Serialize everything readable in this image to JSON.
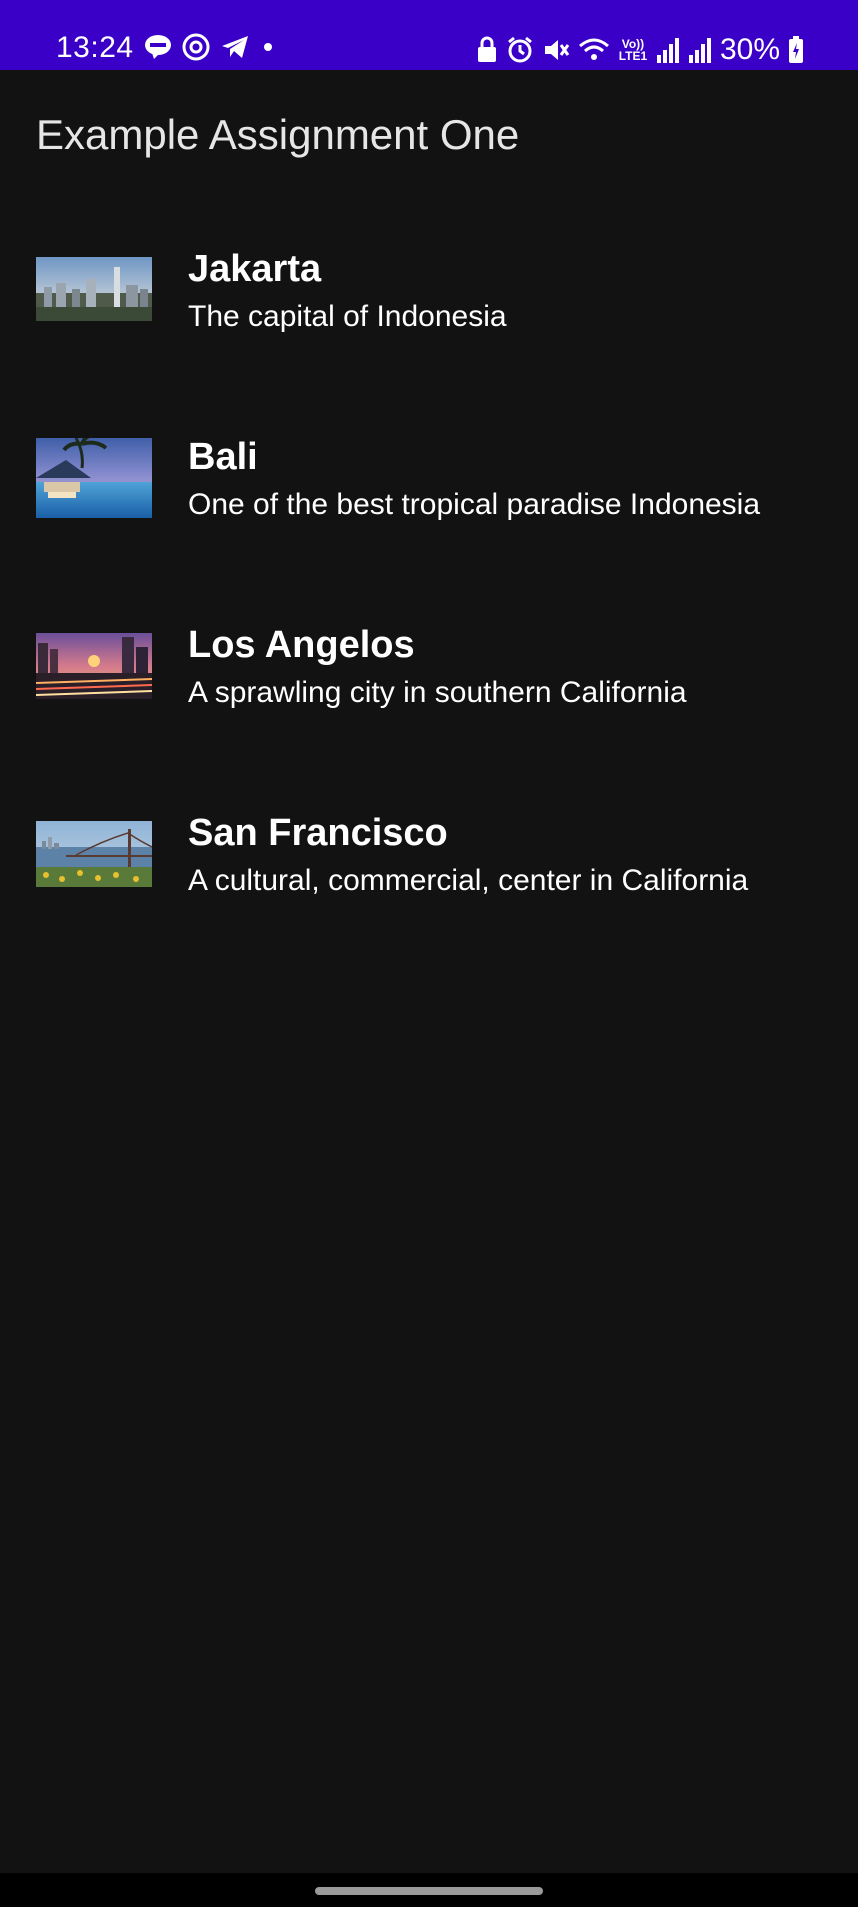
{
  "status_bar": {
    "time": "13:24",
    "battery": "30%",
    "lte_label": "Vo)) LTE1",
    "icons_left": [
      "line-icon",
      "messenger-icon",
      "telegram-icon",
      "dot-icon"
    ],
    "icons_right": [
      "lock-icon",
      "alarm-icon",
      "mute-icon",
      "wifi-icon",
      "lte-icon",
      "signal-icon",
      "signal-icon",
      "battery-icon"
    ]
  },
  "app_bar": {
    "title": "Example Assignment One"
  },
  "cities": [
    {
      "name": "Jakarta",
      "description": "The capital of Indonesia"
    },
    {
      "name": "Bali",
      "description": "One of the best tropical paradise Indonesia"
    },
    {
      "name": "Los Angelos",
      "description": "A sprawling city in southern California"
    },
    {
      "name": "San Francisco",
      "description": "A cultural, commercial, center in California"
    }
  ],
  "colors": {
    "status_bar": "#3a00c8",
    "background": "#121212",
    "text": "#ffffff"
  }
}
